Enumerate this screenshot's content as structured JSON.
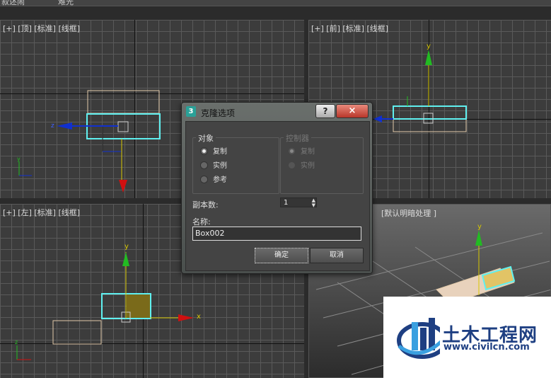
{
  "top_strip": {
    "left_text": "叙述闹",
    "mid_text": "难光"
  },
  "viewports": {
    "top": {
      "label": "[+] [顶] [标准] [线框]"
    },
    "front": {
      "label": "[+] [前] [标准] [线框]",
      "axis_y": "y"
    },
    "left": {
      "label": "[+] [左] [标准] [线框]",
      "axis_y": "y",
      "axis_x": "x"
    },
    "perspective": {
      "label": "[默认明暗处理 ]"
    }
  },
  "dialog": {
    "icon_text": "3",
    "title": "克隆选项",
    "help_label": "?",
    "close_label": "×",
    "object_group": {
      "title": "对象",
      "options": [
        {
          "label": "复制",
          "selected": true
        },
        {
          "label": "实例",
          "selected": false
        },
        {
          "label": "参考",
          "selected": false
        }
      ]
    },
    "controller_group": {
      "title": "控制器",
      "options": [
        {
          "label": "复制",
          "selected": true
        },
        {
          "label": "实例",
          "selected": false
        }
      ]
    },
    "copies_label": "副本数:",
    "copies_value": "1",
    "name_label": "名称:",
    "name_value": "Box002",
    "ok_label": "确定",
    "cancel_label": "取消"
  },
  "watermark": {
    "title": "土木工程网",
    "url": "www.civilcn.com"
  },
  "colors": {
    "selected_box": "#5ff0f0",
    "dim_box": "#e0c8a8",
    "axis_y": "#22bb22",
    "axis_x": "#d01010",
    "axis_z": "#1030d0"
  }
}
